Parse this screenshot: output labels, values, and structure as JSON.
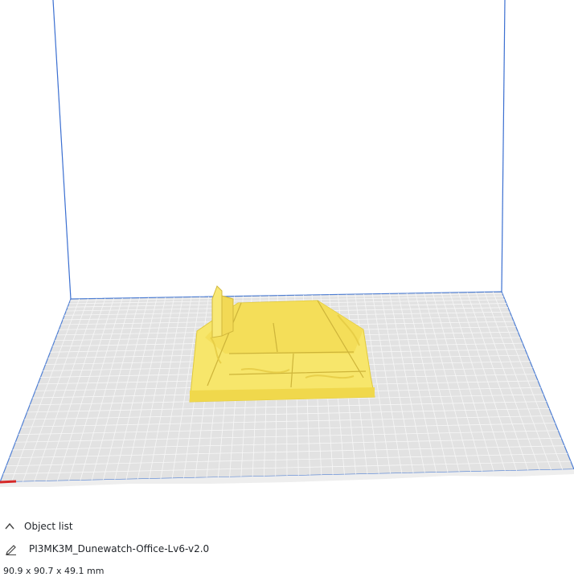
{
  "object_list": {
    "header_label": "Object list",
    "collapse_icon": "chevron-up-icon",
    "edit_icon": "pencil-icon",
    "object_name": "PI3MK3M_Dunewatch-Office-Lv6-v2.0",
    "dimensions": "90.9 x 90.7 x 49.1 mm"
  },
  "viewport": {
    "build_volume_edge_color": "#3b6fd1",
    "plate_color": "#e0e0e0",
    "grid_color": "#ffffff",
    "model_color": "#f7e66b",
    "model_shadow_color": "#e8cf3e",
    "origin_axis_color": "#d62828"
  }
}
